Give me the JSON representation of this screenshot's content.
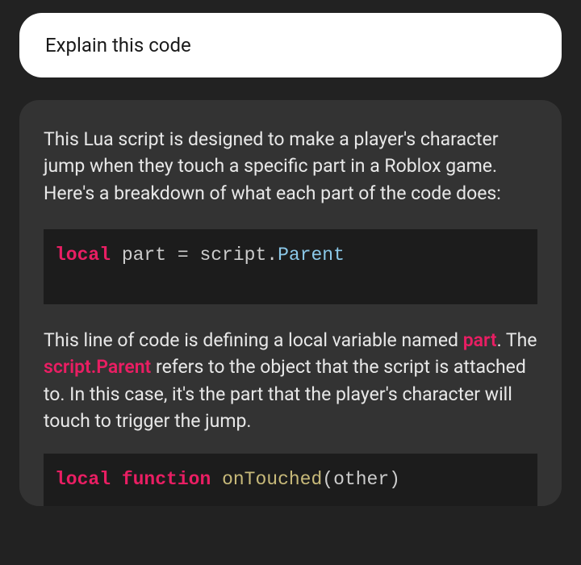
{
  "user": {
    "text": "Explain this code"
  },
  "assistant": {
    "intro": "This Lua script is designed to make a player's character jump when they touch a specific part in a Roblox game. Here's a breakdown of what each part of the code does:",
    "code1": {
      "keyword": "local",
      "var": " part ",
      "op": "= ",
      "obj": "script",
      "dot": ".",
      "prop": "Parent"
    },
    "explanation1": {
      "part1": "This line of code is defining a local variable named ",
      "highlight1": "part",
      "part2": ". The ",
      "highlight2": "script.Parent",
      "part3": "  refers to the object that the script is attached to. In this case, it's the part that the player's character will touch to trigger the jump."
    },
    "code2": {
      "keyword1": "local",
      "space1": " ",
      "keyword2": "function",
      "space2": " ",
      "func": "onTouched",
      "paren1": "(",
      "param": "other",
      "paren2": ")"
    }
  }
}
